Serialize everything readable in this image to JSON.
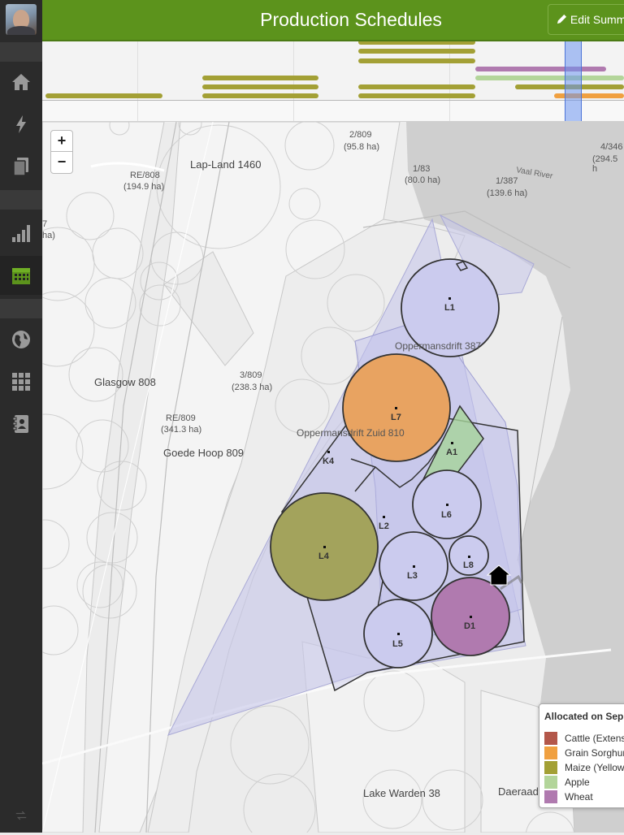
{
  "header": {
    "title": "Production Schedules",
    "edit_label": "Edit Summ"
  },
  "sidebar": {
    "items": [
      "home-icon",
      "lightning-icon",
      "copy-icon",
      "bar-chart-icon",
      "calendar-icon",
      "globe-icon",
      "grid-icon",
      "contacts-icon"
    ],
    "active": "calendar-icon",
    "accent": "#5c931c"
  },
  "timeline": {
    "colors": {
      "maize": "#a3a035",
      "wheat": "#b07aaf",
      "apple": "#b3d59a",
      "sorghum": "#f0a040",
      "today": "#6e96f0"
    }
  },
  "map": {
    "zoom_in": "+",
    "zoom_out": "−",
    "place_labels": {
      "lapland": "Lap-Land 1460",
      "re808": "RE/808",
      "re808_area": "(194.9 ha)",
      "s2_809": "2/809",
      "s2_809_area": "(95.8 ha)",
      "s1_83": "1/83",
      "s1_83_area": "(80.0 ha)",
      "s1_387": "1/387",
      "s1_387_area": "(139.6 ha)",
      "vaal": "Vaal River",
      "s4_346": "4/346",
      "s4_346_area": "(294.5 h",
      "left_frag": "7",
      "left_frag2": "ha)",
      "oppermansdrift": "Oppermansdrift 387",
      "glasgow": "Glasgow 808",
      "s3_809": "3/809",
      "s3_809_area": "(238.3 ha)",
      "re809": "RE/809",
      "re809_area": "(341.3 ha)",
      "goede_hoop": "Goede Hoop 809",
      "oppermansdrift_zuid": "Oppermansdrift Zuid 810",
      "lake_warden": "Lake Warden 38",
      "daeraad": "Daeraad"
    },
    "fields": {
      "L1": "L1",
      "L7": "L7",
      "A1": "A1",
      "K4": "K4",
      "L6": "L6",
      "L2": "L2",
      "L4": "L4",
      "L8": "L8",
      "L3": "L3",
      "D1": "D1",
      "L5": "L5"
    }
  },
  "legend": {
    "title": "Allocated on Sep",
    "items": [
      {
        "label": "Cattle (Extens",
        "color": "#b3574a"
      },
      {
        "label": "Grain Sorghur",
        "color": "#f0a040"
      },
      {
        "label": "Maize (Yellow",
        "color": "#a3a035"
      },
      {
        "label": "Apple",
        "color": "#b3d59a"
      },
      {
        "label": "Wheat",
        "color": "#b07aaf"
      }
    ]
  }
}
